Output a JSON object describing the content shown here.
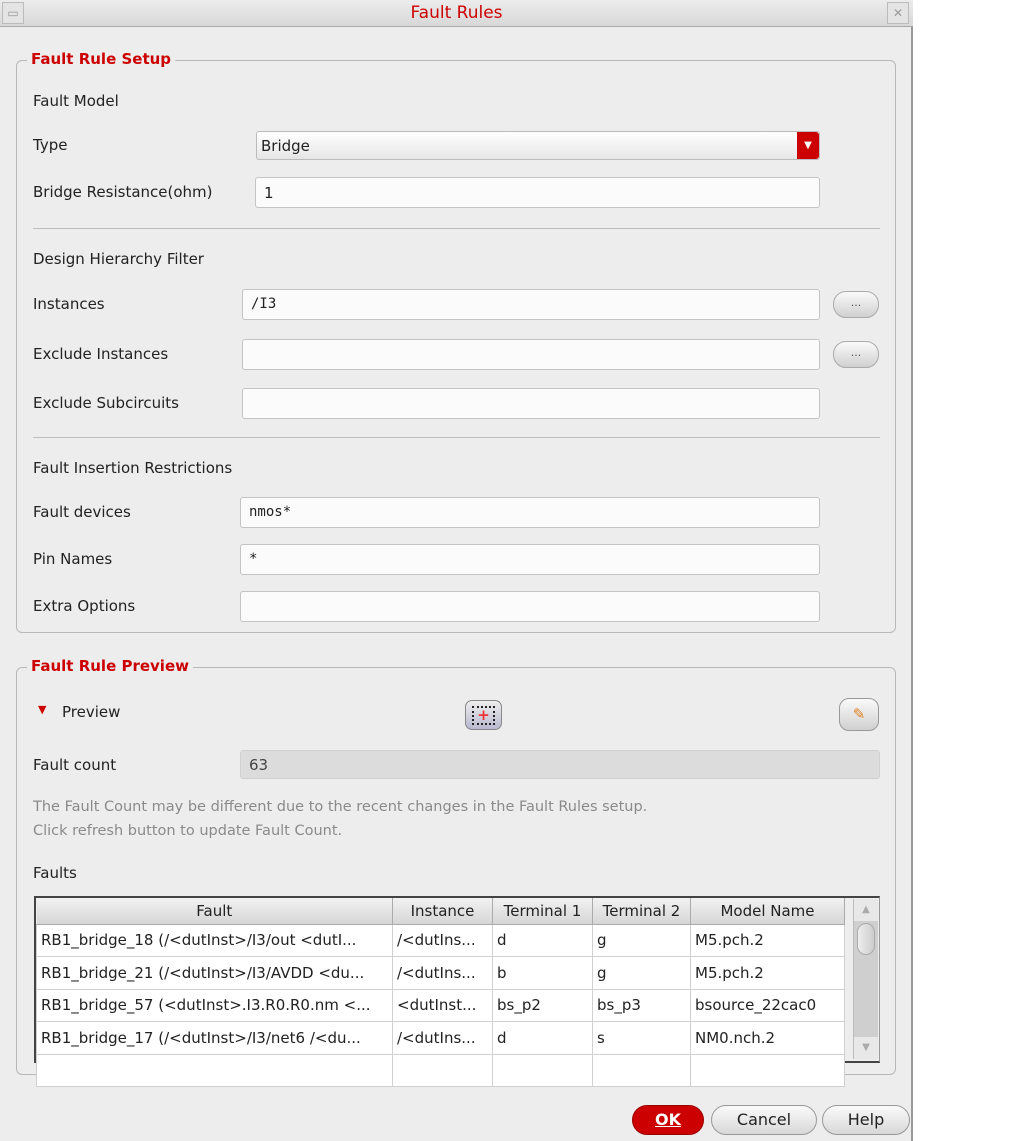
{
  "window": {
    "title": "Fault Rules"
  },
  "setup": {
    "legend": "Fault Rule Setup",
    "fault_model": "Fault Model",
    "type_label": "Type",
    "type_value": "Bridge",
    "resistance_label": "Bridge Resistance(ohm)",
    "resistance_value": "1",
    "hierarchy": "Design Hierarchy Filter",
    "instances_label": "Instances",
    "instances_value": "/I3",
    "exclude_instances_label": "Exclude Instances",
    "exclude_instances_value": "",
    "exclude_subcircuits_label": "Exclude Subcircuits",
    "exclude_subcircuits_value": "",
    "browse_label": "...",
    "restrictions": "Fault Insertion Restrictions",
    "devices_label": "Fault devices",
    "devices_value": "nmos*",
    "pins_label": "Pin Names",
    "pins_value": "*",
    "extra_label": "Extra Options",
    "extra_value": ""
  },
  "preview": {
    "legend": "Fault Rule Preview",
    "toggle": "Preview",
    "count_label": "Fault count",
    "count_value": "63",
    "note1": "The Fault Count may be different due to the recent changes in the Fault Rules setup.",
    "note2": "Click refresh button to update Fault Count.",
    "faults_label": "Faults",
    "columns": [
      "Fault",
      "Instance",
      "Terminal 1",
      "Terminal 2",
      "Model Name"
    ],
    "rows": [
      [
        "RB1_bridge_18 (/<dutInst>/I3/out <dutI...",
        "/<dutIns...",
        "d",
        "g",
        "M5.pch.2"
      ],
      [
        "RB1_bridge_21 (/<dutInst>/I3/AVDD <du...",
        "/<dutIns...",
        "b",
        "g",
        "M5.pch.2"
      ],
      [
        "RB1_bridge_57 (<dutInst>.I3.R0.R0.nm <...",
        "<dutInst...",
        "bs_p2",
        "bs_p3",
        "bsource_22cac0"
      ],
      [
        "RB1_bridge_17 (/<dutInst>/I3/net6 /<du...",
        "/<dutIns...",
        "d",
        "s",
        "NM0.nch.2"
      ]
    ]
  },
  "buttons": {
    "ok": "OK",
    "cancel": "Cancel",
    "help": "Help"
  },
  "colors": {
    "accent": "#cc0000"
  }
}
